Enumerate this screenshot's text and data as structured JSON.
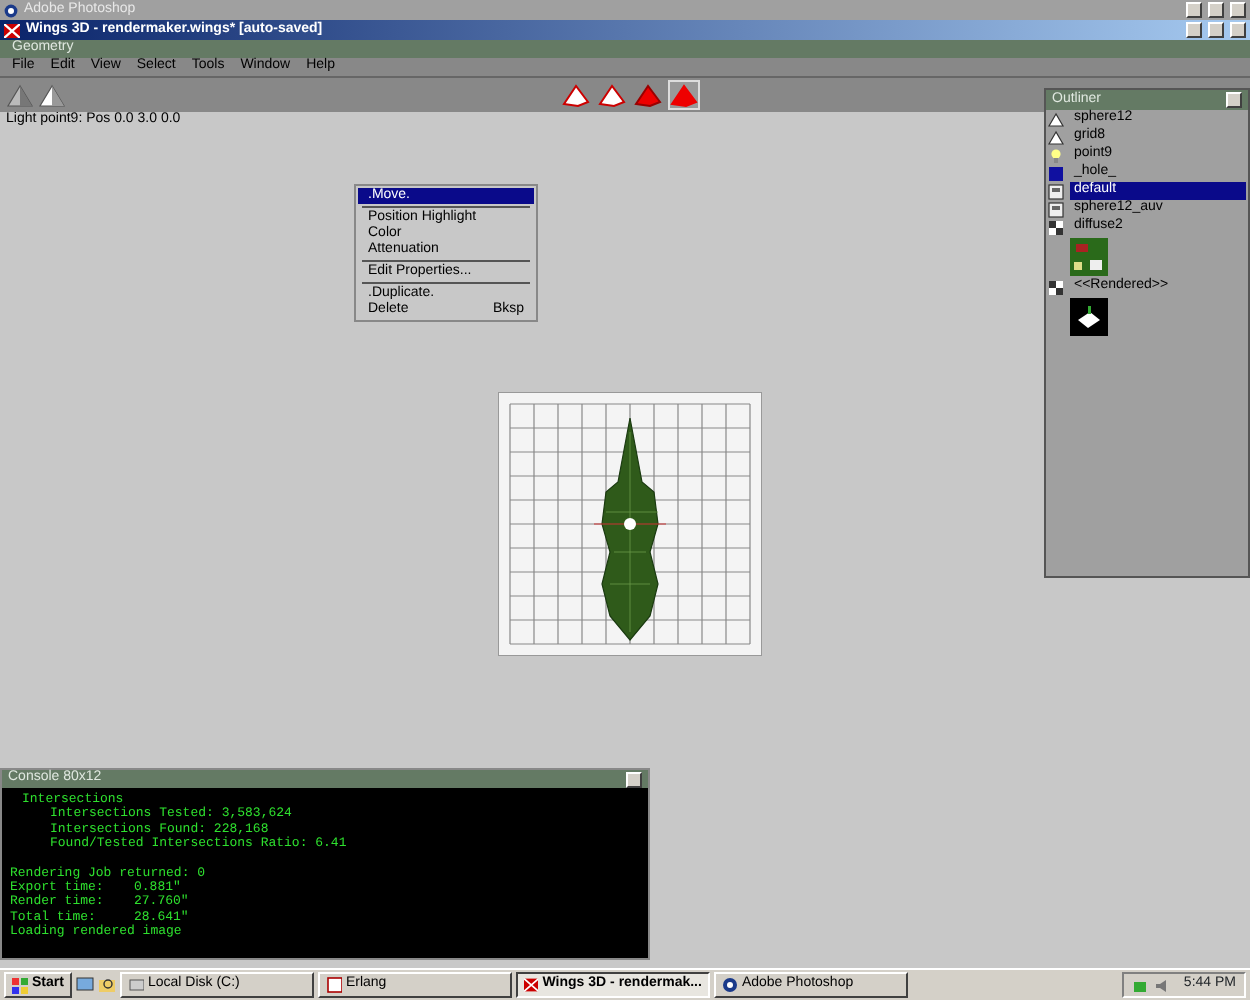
{
  "photoshop_window": {
    "title": "Adobe Photoshop"
  },
  "window": {
    "title": "Wings 3D - rendermaker.wings* [auto-saved]"
  },
  "geometry_bar": {
    "title": "Geometry"
  },
  "menu": [
    "File",
    "Edit",
    "View",
    "Select",
    "Tools",
    "Window",
    "Help"
  ],
  "toolbar": {
    "views": [
      {
        "kind": "shaded"
      },
      {
        "kind": "flat"
      }
    ],
    "modes": [
      {
        "kind": "vertex",
        "selected": false
      },
      {
        "kind": "edge",
        "selected": false
      },
      {
        "kind": "face",
        "selected": false
      },
      {
        "kind": "body",
        "selected": true
      }
    ]
  },
  "info_line": "Light point9: Pos 0.0 3.0 0.0",
  "context_menu": {
    "groups": [
      [
        {
          "label": ".Move.",
          "selected": true
        }
      ],
      [
        {
          "label": "Position Highlight",
          "selected": false
        },
        {
          "label": "Color",
          "selected": false
        },
        {
          "label": "Attenuation",
          "selected": false
        }
      ],
      [
        {
          "label": "Edit Properties...",
          "selected": false
        }
      ],
      [
        {
          "label": ".Duplicate.",
          "selected": false
        },
        {
          "label": "Delete",
          "shortcut": "Bksp",
          "selected": false
        }
      ]
    ]
  },
  "outliner": {
    "title": "Outliner",
    "items": [
      {
        "label": "sphere12",
        "kind": "object",
        "thumbnail": false,
        "selected": false
      },
      {
        "label": "grid8",
        "kind": "object",
        "thumbnail": false,
        "selected": false
      },
      {
        "label": "point9",
        "kind": "light",
        "thumbnail": false,
        "selected": false
      },
      {
        "label": "_hole_",
        "kind": "material",
        "thumbnail": false,
        "selected": false
      },
      {
        "label": "default",
        "kind": "image",
        "thumbnail": false,
        "selected": true
      },
      {
        "label": "sphere12_auv",
        "kind": "image",
        "thumbnail": false,
        "selected": false
      },
      {
        "label": "diffuse2",
        "kind": "texture",
        "thumbnail": true,
        "selected": false
      },
      {
        "label": "<<Rendered>>",
        "kind": "texture",
        "thumbnail": true,
        "selected": false
      }
    ]
  },
  "console": {
    "title": "Console 80x12",
    "sections": [
      [
        {
          "text": "Intersections",
          "children": [
            {
              "text": "Intersections Tested: 3,583,624"
            },
            {
              "text": "Intersections Found: 228,168"
            },
            {
              "text": "Found/Tested Intersections Ratio: 6.41"
            }
          ]
        }
      ],
      [
        {
          "text": "Rendering Job returned: 0"
        },
        {
          "text": "Export time:",
          "value": "0.881\""
        },
        {
          "text": "Render time:",
          "value": "27.760\""
        },
        {
          "text": "Total time:",
          "value": "28.641\""
        },
        {
          "text": "Loading rendered image"
        }
      ]
    ]
  },
  "taskbar": {
    "start": "Start",
    "tasks": [
      {
        "label": "Local Disk (C:)",
        "selected": false
      },
      {
        "label": "Erlang",
        "selected": false
      },
      {
        "label": "Wings 3D - rendermak...",
        "selected": true
      },
      {
        "label": "Adobe Photoshop",
        "selected": false
      }
    ],
    "clock": "5:44 PM"
  }
}
